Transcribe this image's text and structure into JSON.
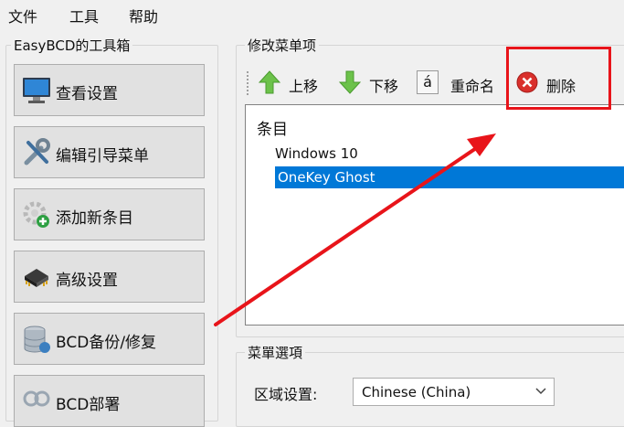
{
  "menubar": {
    "items": [
      "文件",
      "工具",
      "帮助"
    ]
  },
  "toolbox": {
    "title": "EasyBCD的工具箱",
    "buttons": [
      {
        "label": "查看设置",
        "icon": "monitor-icon"
      },
      {
        "label": "编辑引导菜单",
        "icon": "tools-icon"
      },
      {
        "label": "添加新条目",
        "icon": "gear-add-icon"
      },
      {
        "label": "高级设置",
        "icon": "chip-icon"
      },
      {
        "label": "BCD备份/修复",
        "icon": "database-icon"
      },
      {
        "label": "BCD部署",
        "icon": "deploy-icon"
      }
    ]
  },
  "modify_menu": {
    "title": "修改菜单项",
    "toolbar": {
      "move_up": "上移",
      "move_down": "下移",
      "rename_glyph": "á",
      "rename": "重命名",
      "delete": "删除"
    },
    "list": {
      "header": "条目",
      "items": [
        "Windows 10",
        "OneKey Ghost"
      ],
      "selected_index": 1
    }
  },
  "menu_options": {
    "title": "菜單選項",
    "locale_label": "区域设置:",
    "locale_value": "Chinese (China)"
  },
  "colors": {
    "selection": "#0078d7",
    "annotation": "#e8141a"
  }
}
